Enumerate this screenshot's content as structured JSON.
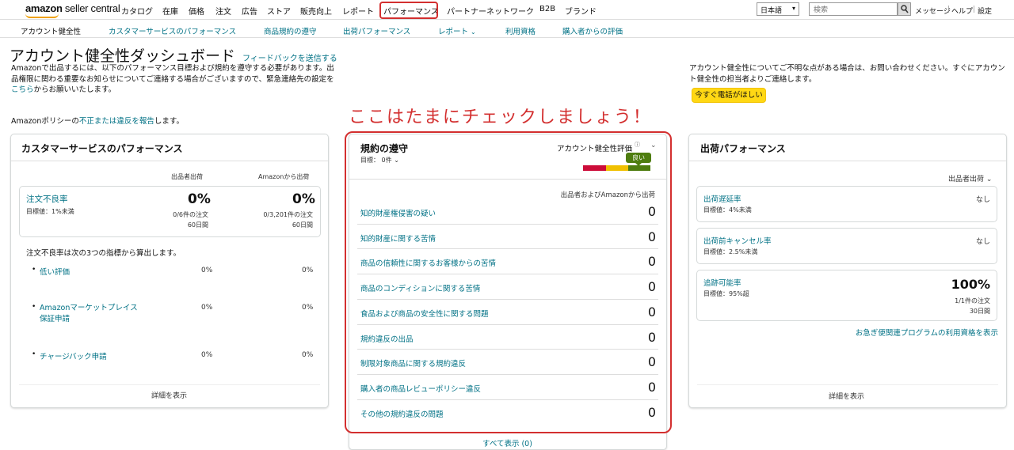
{
  "app": {
    "logo_part1": "amazon",
    "logo_part2": "seller central"
  },
  "topnav": {
    "items": [
      "カタログ",
      "在庫",
      "価格",
      "注文",
      "広告",
      "ストア",
      "販売向上",
      "レポート",
      "パフォーマンス",
      "パートナーネットワーク",
      "B2B",
      "ブランド"
    ],
    "language": "日本語",
    "search_placeholder": "検索",
    "messages": "メッセージ",
    "help": "ヘルプ",
    "settings": "設定"
  },
  "subnav": {
    "items": [
      "アカウント健全性",
      "カスタマーサービスのパフォーマンス",
      "商品規約の遵守",
      "出荷パフォーマンス",
      "レポート",
      "利用資格",
      "購入者からの評価"
    ]
  },
  "header": {
    "title": "アカウント健全性ダッシュボード",
    "feedback": "フィードバックを送信する",
    "intro": "Amazonで出品するには、以下のパフォーマンス目標および規約を遵守する必要があります。出品権限に関わる重要なお知らせについてご連絡する場合がございますので、緊急連絡先の設定を",
    "intro_link": "こちら",
    "intro_end": "からお願いいたします。",
    "policy_pre": "Amazonポリシーの",
    "policy_link": "不正または違反を報告",
    "policy_post": "します。",
    "contact": "アカウント健全性についてご不明な点がある場合は、お問い合わせください。すぐにアカウント健全性の担当者よりご連絡します。",
    "call_button": "今すぐ電話がほしい"
  },
  "annotation": "ここはたまにチェックしましょう！",
  "customer_service": {
    "title": "カスタマーサービスのパフォーマンス",
    "col_seller": "出品者出荷",
    "col_amazon": "Amazonから出荷",
    "odr_label": "注文不良率",
    "odr_target": "目標値：1%未満",
    "odr_seller": "0%",
    "odr_seller_detail": "0/6件の注文",
    "odr_seller_period": "60日間",
    "odr_amazon": "0%",
    "odr_amazon_detail": "0/3,201件の注文",
    "odr_amazon_period": "60日間",
    "note": "注文不良率は次の3つの指標から算出します。",
    "metrics": [
      {
        "label": "低い評価",
        "seller": "0%",
        "amazon": "0%"
      },
      {
        "label": "Amazonマーケットプレイス保証申請",
        "seller": "0%",
        "amazon": "0%"
      },
      {
        "label": "チャージバック申請",
        "seller": "0%",
        "amazon": "0%"
      }
    ],
    "details": "詳細を表示"
  },
  "policy": {
    "title": "規約の遵守",
    "target": "目標： 0件",
    "rating_label": "アカウント健全性評価",
    "rating_value": "良い",
    "col": "出品者およびAmazonから出荷",
    "rows": [
      {
        "label": "知的財産権侵害の疑い",
        "value": "0"
      },
      {
        "label": "知的財産に関する苦情",
        "value": "0"
      },
      {
        "label": "商品の信頼性に関するお客様からの苦情",
        "value": "0"
      },
      {
        "label": "商品のコンディションに関する苦情",
        "value": "0"
      },
      {
        "label": "食品および商品の安全性に関する問題",
        "value": "0"
      },
      {
        "label": "規約違反の出品",
        "value": "0"
      },
      {
        "label": "制限対象商品に関する規約違反",
        "value": "0"
      },
      {
        "label": "購入者の商品レビューポリシー違反",
        "value": "0"
      },
      {
        "label": "その他の規約違反の問題",
        "value": "0"
      }
    ],
    "show_all": "すべて表示 (0)",
    "colors": {
      "red": "#cc0c39",
      "yellow": "#f0c000",
      "green": "#4e7d10"
    }
  },
  "shipping": {
    "title": "出荷パフォーマンス",
    "col": "出品者出荷",
    "metrics": [
      {
        "label": "出荷遅延率",
        "target": "目標値：4%未満",
        "value": "なし"
      },
      {
        "label": "出荷前キャンセル率",
        "target": "目標値：2.5%未満",
        "value": "なし"
      },
      {
        "label": "追跡可能率",
        "target": "目標値：95%超",
        "value": "100%",
        "detail": "1/1件の注文",
        "period": "30日間"
      }
    ],
    "program_link": "お急ぎ便関連プログラムの利用資格を表示",
    "details": "詳細を表示"
  }
}
